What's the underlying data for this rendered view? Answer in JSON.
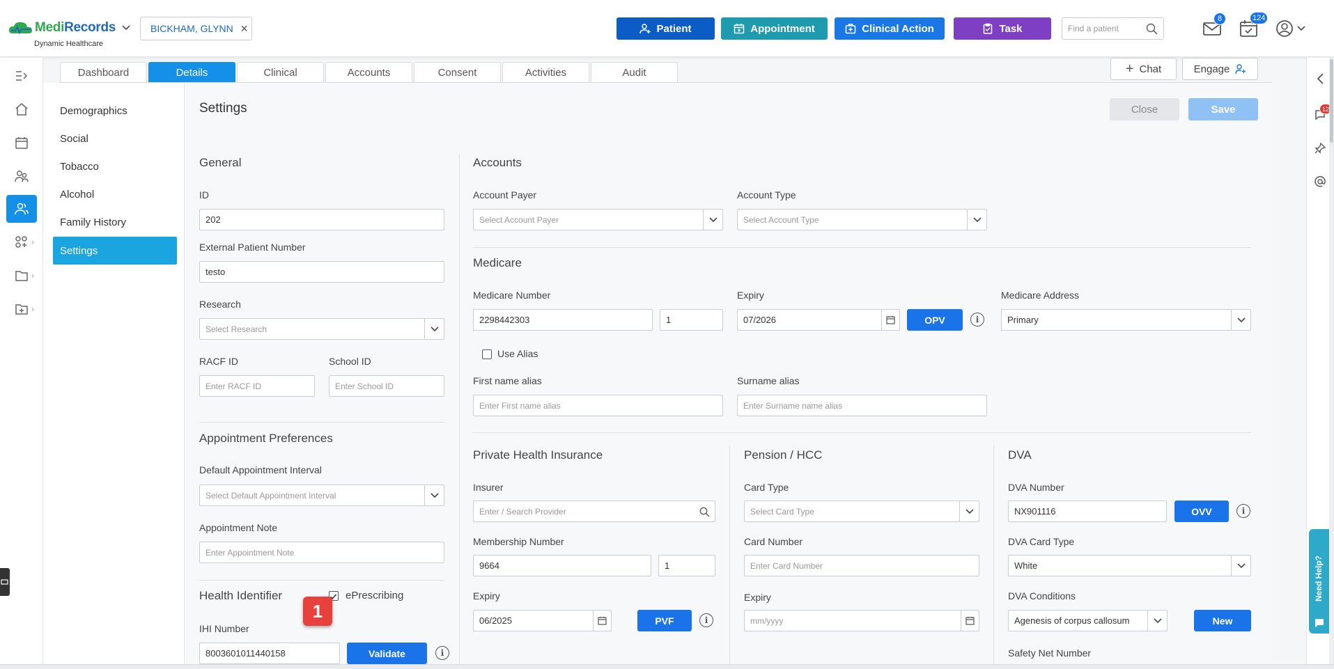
{
  "header": {
    "logo_part1": "Medi",
    "logo_part2": "Records",
    "logo_sub": "Dynamic Healthcare",
    "patient_chip": "BICKHAM, GLYNN",
    "buttons": {
      "patient": "Patient",
      "appointment": "Appointment",
      "clinical_action": "Clinical Action",
      "task": "Task"
    },
    "search_placeholder": "Find a patient",
    "mail_count": "8",
    "calendar_count": "124",
    "colors": {
      "patient": "#0b5cc4",
      "appointment": "#1f9bb0",
      "clinical_action": "#1a78e6",
      "task": "#7e3fc4"
    }
  },
  "right_rail": {
    "notif_count": "12",
    "help_label": "Need Help?"
  },
  "tabs": [
    "Dashboard",
    "Details",
    "Clinical",
    "Accounts",
    "Consent",
    "Activities",
    "Audit"
  ],
  "active_tab": "Details",
  "header_actions": {
    "chat": "Chat",
    "engage": "Engage"
  },
  "subnav": [
    "Demographics",
    "Social",
    "Tobacco",
    "Alcohol",
    "Family History",
    "Settings"
  ],
  "page": {
    "title": "Settings",
    "close": "Close",
    "save": "Save"
  },
  "general": {
    "title": "General",
    "id_label": "ID",
    "id_value": "202",
    "ext_label": "External Patient Number",
    "ext_value": "testo",
    "research_label": "Research",
    "research_ph": "Select Research",
    "racf_label": "RACF ID",
    "racf_ph": "Enter RACF ID",
    "school_label": "School ID",
    "school_ph": "Enter School ID"
  },
  "appt": {
    "title": "Appointment Preferences",
    "interval_label": "Default Appointment Interval",
    "interval_ph": "Select Default Appointment Interval",
    "note_label": "Appointment Note",
    "note_ph": "Enter Appointment Note"
  },
  "health": {
    "title": "Health Identifier",
    "eprescribing": "ePrescribing",
    "ihi_label": "IHI Number",
    "ihi_value": "8003601011440158",
    "validate": "Validate",
    "marker": "1"
  },
  "accounts": {
    "title": "Accounts",
    "payer_label": "Account Payer",
    "payer_ph": "Select Account Payer",
    "type_label": "Account Type",
    "type_ph": "Select Account Type"
  },
  "medicare": {
    "title": "Medicare",
    "number_label": "Medicare Number",
    "number_value": "2298442303",
    "irn_value": "1",
    "expiry_label": "Expiry",
    "expiry_value": "07/2026",
    "opv": "OPV",
    "address_label": "Medicare Address",
    "address_value": "Primary",
    "use_alias": "Use Alias",
    "first_alias_label": "First name alias",
    "first_alias_ph": "Enter First name alias",
    "surname_alias_label": "Surname alias",
    "surname_alias_ph": "Enter Surname name alias"
  },
  "phi": {
    "title": "Private Health Insurance",
    "insurer_label": "Insurer",
    "insurer_ph": "Enter / Search Provider",
    "member_label": "Membership Number",
    "member_value": "9664",
    "member_seq": "1",
    "expiry_label": "Expiry",
    "expiry_value": "06/2025",
    "pvf": "PVF"
  },
  "pension": {
    "title": "Pension / HCC",
    "card_type_label": "Card Type",
    "card_type_ph": "Select Card Type",
    "card_number_label": "Card Number",
    "card_number_ph": "Enter Card Number",
    "expiry_label": "Expiry",
    "expiry_ph": "mm/yyyy"
  },
  "dva": {
    "title": "DVA",
    "number_label": "DVA Number",
    "number_value": "NX901116",
    "ovv": "OVV",
    "card_type_label": "DVA Card Type",
    "card_type_value": "White",
    "conditions_label": "DVA Conditions",
    "conditions_value": "Agenesis of corpus callosum",
    "new": "New",
    "safety_label": "Safety Net Number"
  }
}
